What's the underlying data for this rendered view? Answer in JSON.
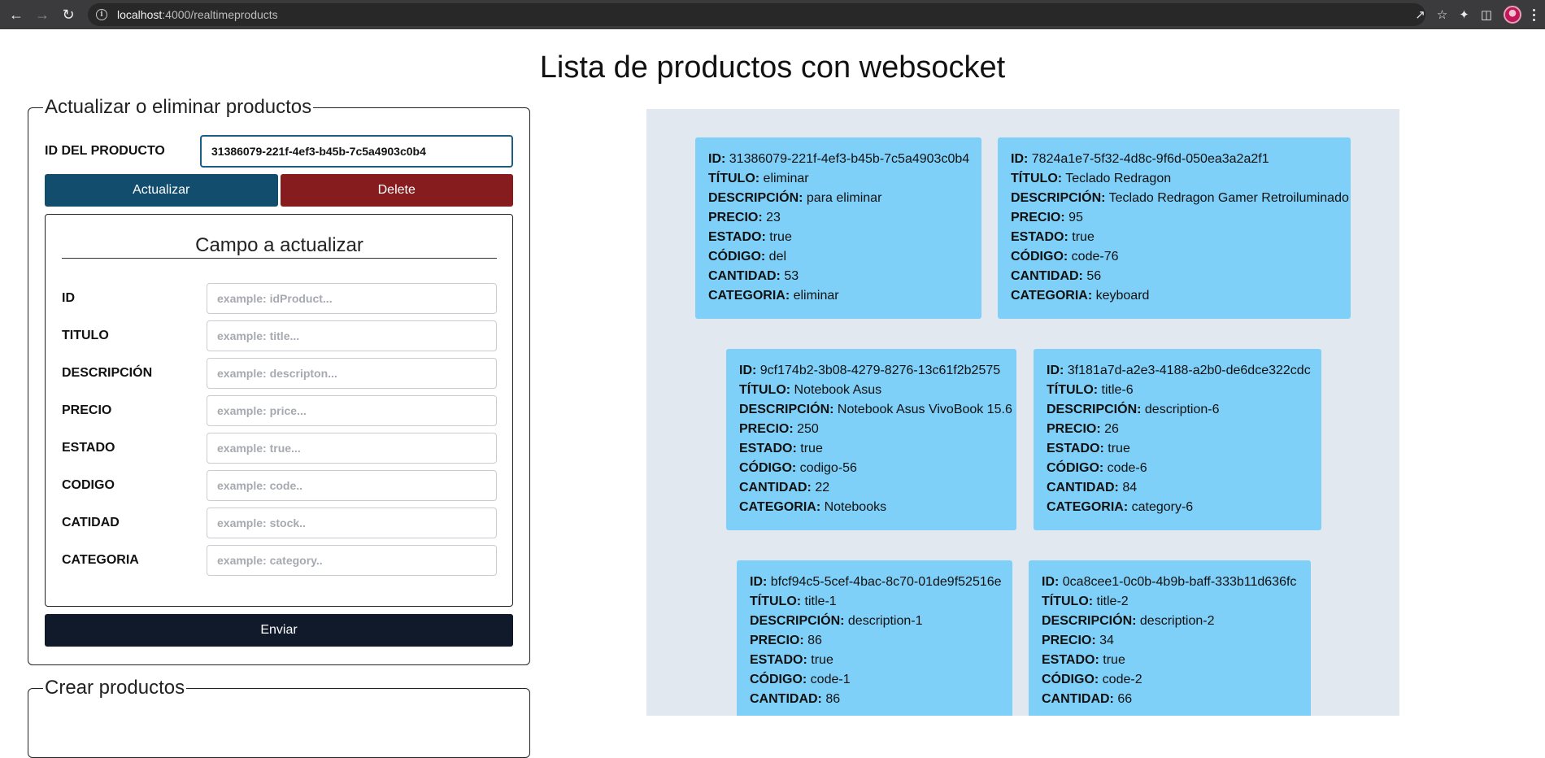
{
  "browser": {
    "url_host": "localhost",
    "url_rest": ":4000/realtimeproducts"
  },
  "page": {
    "title": "Lista de productos con websocket"
  },
  "update_section": {
    "legend": "Actualizar o eliminar productos",
    "id_label": "ID DEL PRODUCTO",
    "id_value": "31386079-221f-4ef3-b45b-7c5a4903c0b4",
    "update_button": "Actualizar",
    "delete_button": "Delete",
    "card_title": "Campo a actualizar",
    "fields": [
      {
        "label": "ID",
        "placeholder": "example: idProduct..."
      },
      {
        "label": "TITULO",
        "placeholder": "example: title..."
      },
      {
        "label": "DESCRIPCIÓN",
        "placeholder": "example: descripton..."
      },
      {
        "label": "PRECIO",
        "placeholder": "example: price..."
      },
      {
        "label": "ESTADO",
        "placeholder": "example: true..."
      },
      {
        "label": "CODIGO",
        "placeholder": "example: code.."
      },
      {
        "label": "CATIDAD",
        "placeholder": "example: stock.."
      },
      {
        "label": "CATEGORIA",
        "placeholder": "example: category.."
      }
    ],
    "send_button": "Enviar"
  },
  "create_section": {
    "legend": "Crear productos"
  },
  "product_labels": {
    "id": "ID:",
    "title": "TÍTULO:",
    "description": "DESCRIPCIÓN:",
    "price": "PRECIO:",
    "status": "ESTADO:",
    "code": "CÓDIGO:",
    "stock": "CANTIDAD:",
    "category": "CATEGORIA:"
  },
  "products": [
    {
      "id": "31386079-221f-4ef3-b45b-7c5a4903c0b4",
      "title": "eliminar",
      "description": "para eliminar",
      "price": "23",
      "status": "true",
      "code": "del",
      "stock": "53",
      "category": "eliminar"
    },
    {
      "id": "7824a1e7-5f32-4d8c-9f6d-050ea3a2a2f1",
      "title": "Teclado Redragon",
      "description": "Teclado Redragon Gamer Retroiluminado",
      "price": "95",
      "status": "true",
      "code": "code-76",
      "stock": "56",
      "category": "keyboard"
    },
    {
      "id": "9cf174b2-3b08-4279-8276-13c61f2b2575",
      "title": "Notebook Asus",
      "description": "Notebook Asus VivoBook 15.6",
      "price": "250",
      "status": "true",
      "code": "codigo-56",
      "stock": "22",
      "category": "Notebooks"
    },
    {
      "id": "3f181a7d-a2e3-4188-a2b0-de6dce322cdc",
      "title": "title-6",
      "description": "description-6",
      "price": "26",
      "status": "true",
      "code": "code-6",
      "stock": "84",
      "category": "category-6"
    },
    {
      "id": "bfcf94c5-5cef-4bac-8c70-01de9f52516e",
      "title": "title-1",
      "description": "description-1",
      "price": "86",
      "status": "true",
      "code": "code-1",
      "stock": "86",
      "category": ""
    },
    {
      "id": "0ca8cee1-0c0b-4b9b-baff-333b11d636fc",
      "title": "title-2",
      "description": "description-2",
      "price": "34",
      "status": "true",
      "code": "code-2",
      "stock": "66",
      "category": ""
    }
  ]
}
